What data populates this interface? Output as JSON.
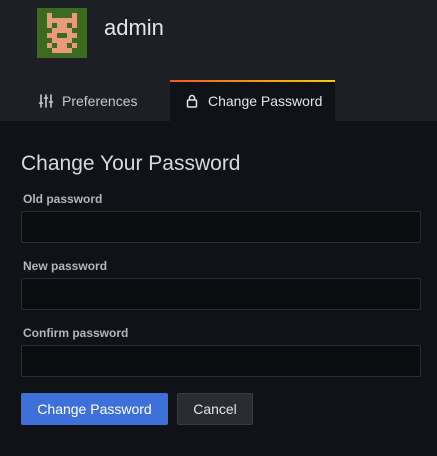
{
  "header": {
    "username": "admin"
  },
  "tabs": [
    {
      "label": "Preferences",
      "icon": "sliders-icon",
      "active": false
    },
    {
      "label": "Change Password",
      "icon": "lock-icon",
      "active": true
    }
  ],
  "form": {
    "title": "Change Your Password",
    "fields": [
      {
        "label": "Old password",
        "value": "",
        "type": "password"
      },
      {
        "label": "New password",
        "value": "",
        "type": "password"
      },
      {
        "label": "Confirm password",
        "value": "",
        "type": "password"
      }
    ],
    "submit_label": "Change Password",
    "cancel_label": "Cancel"
  },
  "colors": {
    "accent": "#3d71d9",
    "tab_gradient_start": "#f05a28",
    "tab_gradient_end": "#fbca0a",
    "background": "#111217",
    "header_background": "#1e1f24"
  }
}
